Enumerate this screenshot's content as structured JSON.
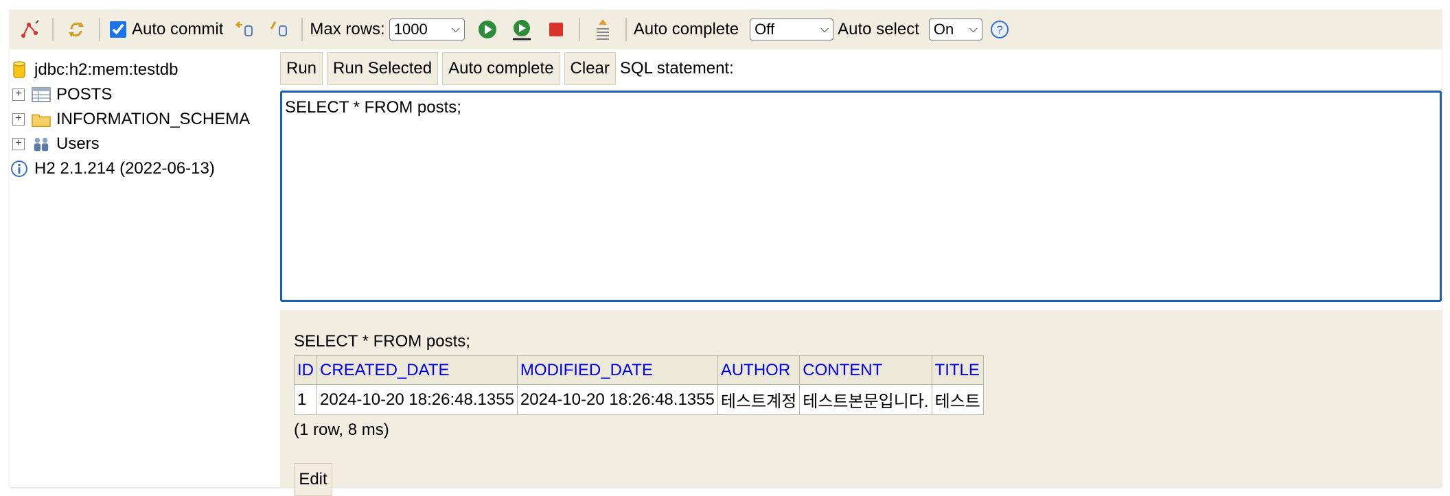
{
  "toolbar": {
    "auto_commit_label": "Auto commit",
    "auto_commit_checked": true,
    "max_rows_label": "Max rows:",
    "max_rows_value": "1000",
    "auto_complete_label": "Auto complete",
    "auto_complete_value": "Off",
    "auto_select_label": "Auto select",
    "auto_select_value": "On",
    "help_glyph": "?"
  },
  "tree": {
    "connection": "jdbc:h2:mem:testdb",
    "items": [
      {
        "label": "POSTS",
        "icon": "table-icon"
      },
      {
        "label": "INFORMATION_SCHEMA",
        "icon": "folder-icon"
      },
      {
        "label": "Users",
        "icon": "users-icon"
      }
    ],
    "version": "H2 2.1.214 (2022-06-13)"
  },
  "query": {
    "run_label": "Run",
    "run_selected_label": "Run Selected",
    "auto_complete_label": "Auto complete",
    "clear_label": "Clear",
    "statement_label": "SQL statement:",
    "sql_text": "SELECT * FROM posts;"
  },
  "results": {
    "sql": "SELECT * FROM posts;",
    "columns": [
      "ID",
      "CREATED_DATE",
      "MODIFIED_DATE",
      "AUTHOR",
      "CONTENT",
      "TITLE"
    ],
    "rows": [
      [
        "1",
        "2024-10-20 18:26:48.1355",
        "2024-10-20 18:26:48.1355",
        "테스트계정",
        "테스트본문입니다.",
        "테스트"
      ]
    ],
    "info": "(1 row, 8 ms)",
    "edit_label": "Edit"
  },
  "colors": {
    "panel_bg": "#f1eee1",
    "link_blue": "#0000ee",
    "editor_border": "#1a5fb4",
    "run_green": "#2e8b3a",
    "stop_red": "#d9342b"
  }
}
